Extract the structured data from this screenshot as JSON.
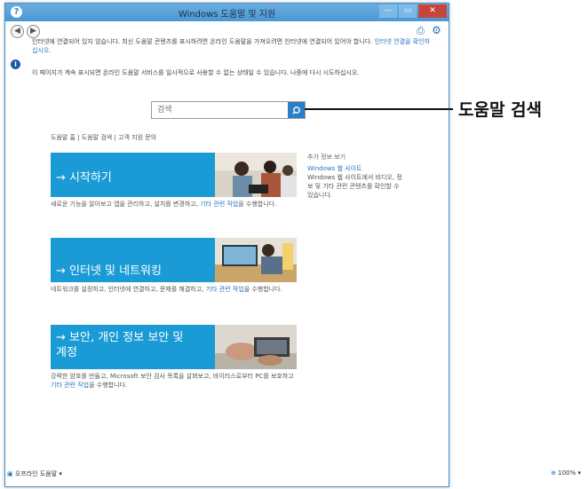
{
  "window": {
    "title": "Windows 도움말 및 지원",
    "buttons": {
      "minimize": "—",
      "maximize": "▭",
      "close": "✕"
    }
  },
  "nav": {
    "back": "◀",
    "forward": "▶",
    "print": "⎙",
    "settings": "⚙"
  },
  "notice": {
    "text": "인터넷에 연결되어 있지 않습니다. 최신 도움말 콘텐츠를 표시하려면 온라인 도움말을 가져오려면 인터넷에 연결되어 있어야 합니다.",
    "link": "인터넷 연결을 확인하십시오."
  },
  "notice2": "이 페이지가 계속 표시되면 온라인 도움말 서비스를 일시적으로 사용할 수 없는 상태일 수 있습니다. 나중에 다시 시도하십시오.",
  "search": {
    "placeholder": "검색"
  },
  "breadcrumb": "도움말 홈 | 도움말 검색 | 고객 지원 문의",
  "tiles": [
    {
      "label": "→ 시작하기",
      "desc_pre": "새로운 기능을 알아보고 앱을 관리하고, 설치를 변경하고, ",
      "desc_link": "기타 관련 작업",
      "desc_post": "을 수행합니다."
    },
    {
      "label": "→ 인터넷 및 네트워킹",
      "desc_pre": "네트워크를 설정하고, 인터넷에 연결하고, 문제를 해결하고, ",
      "desc_link": "기타 관련 작업",
      "desc_post": "을 수행합니다."
    },
    {
      "label_line1": "→ 보안, 개인 정보 보안 및",
      "label_line2": "계정",
      "desc_pre": "강력한 암호를 만들고, Microsoft 보안 검사 목록을 살펴보고, 바이러스로부터 PC를 보호하고 ",
      "desc_link": "기타 관련 작업",
      "desc_post": "을 수행합니다."
    }
  ],
  "side": {
    "title": "추가 정보 보기",
    "link": "Windows 웹 사이트",
    "text": "Windows 웹 사이트에서 비디오, 정보 및 기타 관련 콘텐츠를 확인할 수 있습니다."
  },
  "footer": {
    "left": "오프라인 도움말 ▾",
    "right": "100% ▾"
  },
  "callout": "도움말 검색",
  "colors": {
    "accent": "#1a9bd6",
    "titlebar": "#4b97d3",
    "link": "#2a76c0"
  }
}
